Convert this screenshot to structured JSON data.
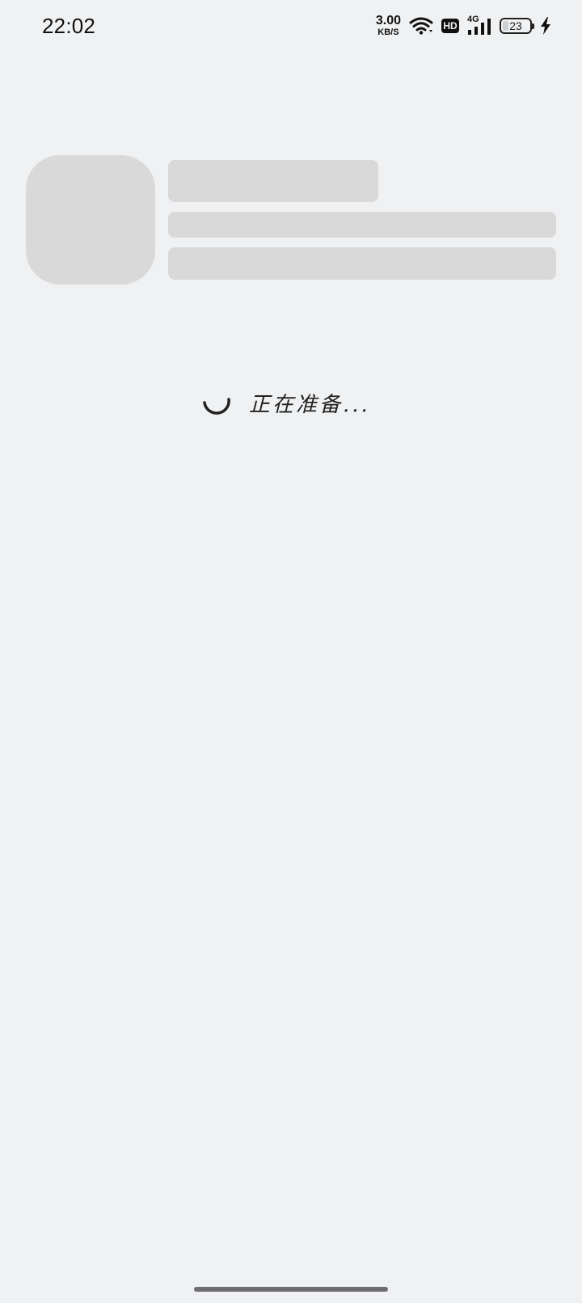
{
  "status_bar": {
    "time": "22:02",
    "net_speed_value": "3.00",
    "net_speed_unit": "KB/S",
    "hd_label": "HD",
    "network_type": "4G",
    "battery_percent": "23"
  },
  "loading": {
    "text": "正在准备..."
  },
  "icons": [
    "wifi-icon",
    "hd-icon",
    "signal-icon",
    "battery-icon",
    "charging-icon",
    "spinner-icon"
  ]
}
